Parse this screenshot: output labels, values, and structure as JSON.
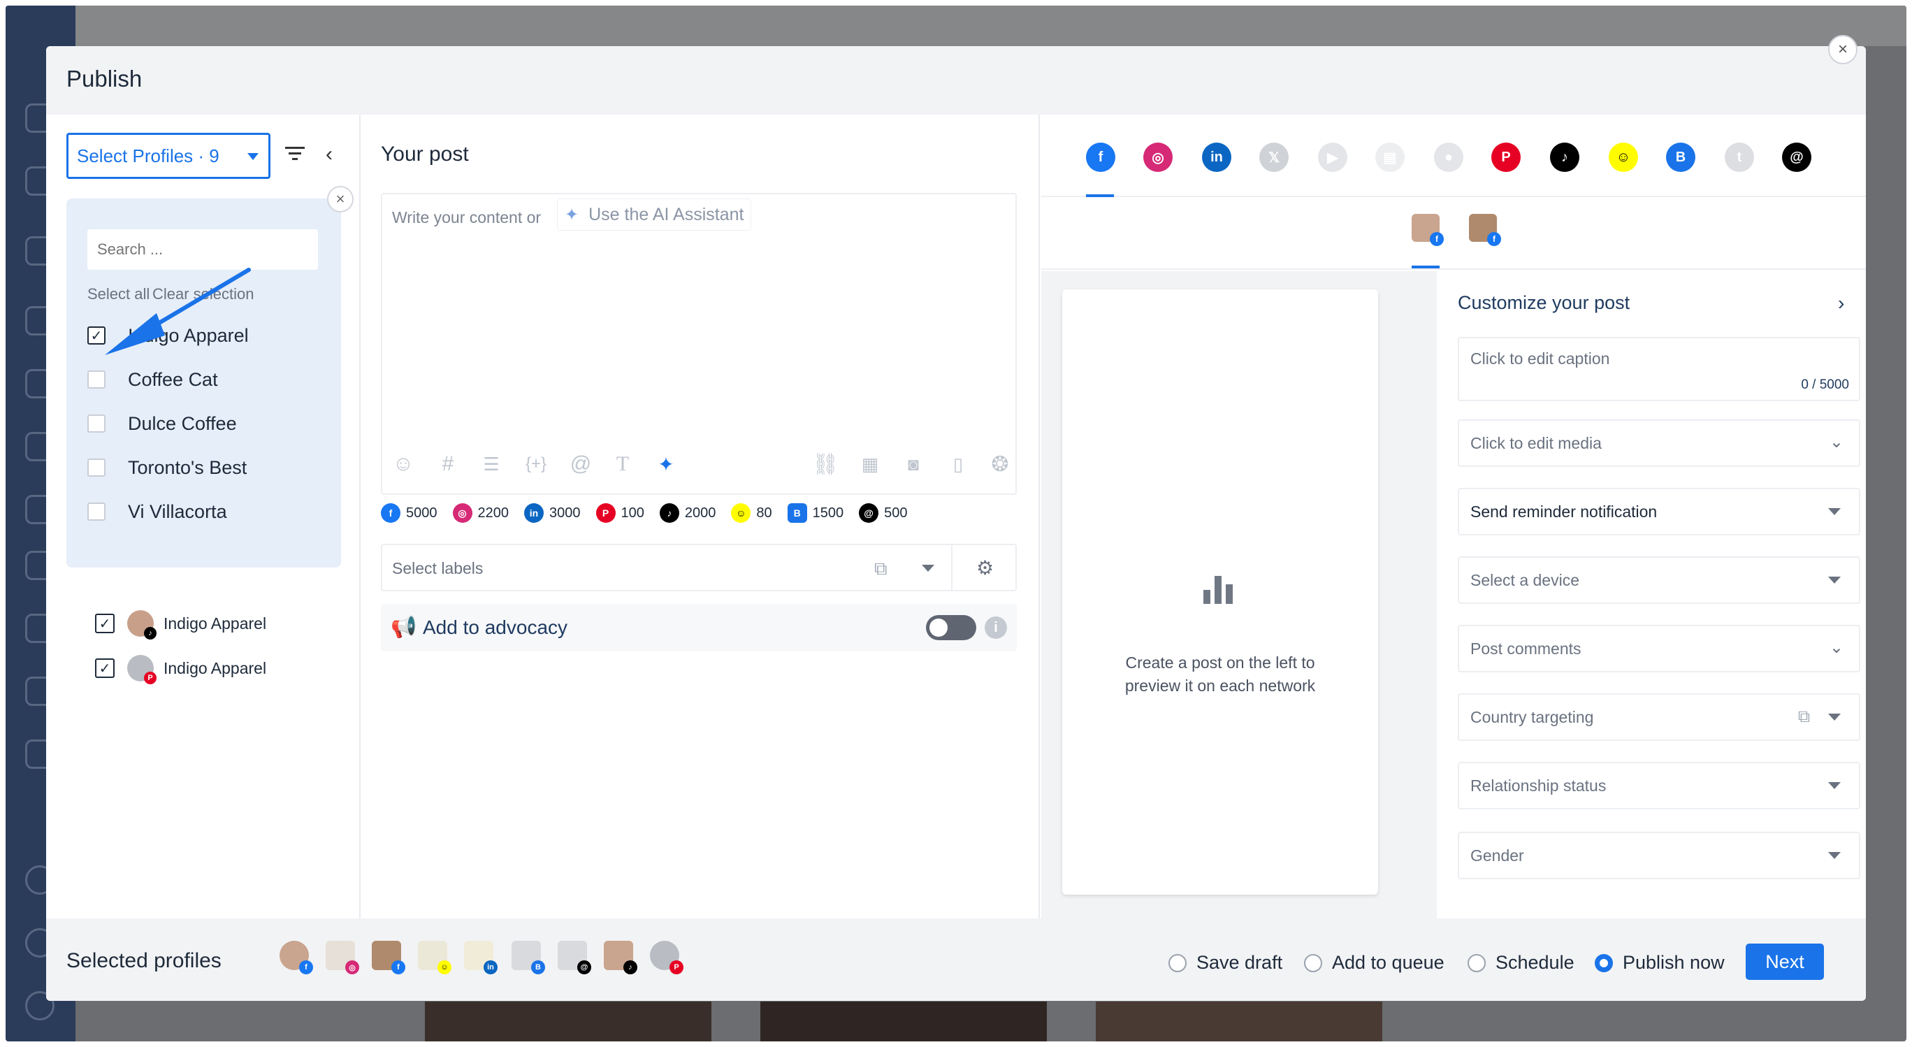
{
  "modal": {
    "title": "Publish",
    "close_icon": "×"
  },
  "left": {
    "select_profiles_label": "Select Profiles · 9",
    "dropdown": {
      "search_placeholder": "Search ...",
      "select_all": "Select all",
      "clear_selection": "Clear selection",
      "items": [
        {
          "label": "Indigo Apparel",
          "checked": true
        },
        {
          "label": "Coffee Cat",
          "checked": false
        },
        {
          "label": "Dulce Coffee",
          "checked": false
        },
        {
          "label": "Toronto's Best",
          "checked": false
        },
        {
          "label": "Vi Villacorta",
          "checked": false
        }
      ]
    },
    "selected_list": [
      {
        "name": "Indigo Apparel",
        "network": "tiktok"
      },
      {
        "name": "Indigo Apparel",
        "network": "pinterest"
      }
    ]
  },
  "post": {
    "heading": "Your post",
    "placeholder": "Write your content or",
    "ai_label": "Use the AI Assistant",
    "limits": [
      {
        "network": "facebook",
        "value": "5000",
        "color": "#1877f2"
      },
      {
        "network": "instagram",
        "value": "2200",
        "color": "#d62976"
      },
      {
        "network": "linkedin",
        "value": "3000",
        "color": "#0a66c2"
      },
      {
        "network": "pinterest",
        "value": "100",
        "color": "#e60023"
      },
      {
        "network": "tiktok",
        "value": "2000",
        "color": "#000000"
      },
      {
        "network": "snapchat",
        "value": "80",
        "color": "#fffc00"
      },
      {
        "network": "google-business",
        "value": "1500",
        "color": "#1a73e8"
      },
      {
        "network": "threads",
        "value": "500",
        "color": "#000000"
      }
    ],
    "labels_placeholder": "Select labels",
    "advocacy_label": "Add to advocacy"
  },
  "preview": {
    "networks": [
      "facebook",
      "instagram",
      "linkedin",
      "x",
      "youtube",
      "google-business-muted",
      "reddit",
      "pinterest",
      "tiktok",
      "snapchat",
      "google-business",
      "tumblr",
      "threads"
    ],
    "empty_text_line1": "Create a post on the left to",
    "empty_text_line2": "preview it on each network"
  },
  "customize": {
    "title": "Customize your post",
    "caption_placeholder": "Click to edit caption",
    "caption_count": "0 / 5000",
    "media_label": "Click to edit media",
    "reminder_label": "Send reminder notification",
    "device_label": "Select a device",
    "comments_label": "Post comments",
    "country_label": "Country targeting",
    "relationship_label": "Relationship status",
    "gender_label": "Gender"
  },
  "footer": {
    "selected_label": "Selected profiles",
    "options": [
      {
        "label": "Save draft",
        "selected": false
      },
      {
        "label": "Add to queue",
        "selected": false
      },
      {
        "label": "Schedule",
        "selected": false
      },
      {
        "label": "Publish now",
        "selected": true
      }
    ],
    "next_label": "Next"
  },
  "colors": {
    "accent": "#1a73e8",
    "facebook": "#1877f2",
    "pinterest": "#e60023",
    "tiktok": "#000000"
  }
}
